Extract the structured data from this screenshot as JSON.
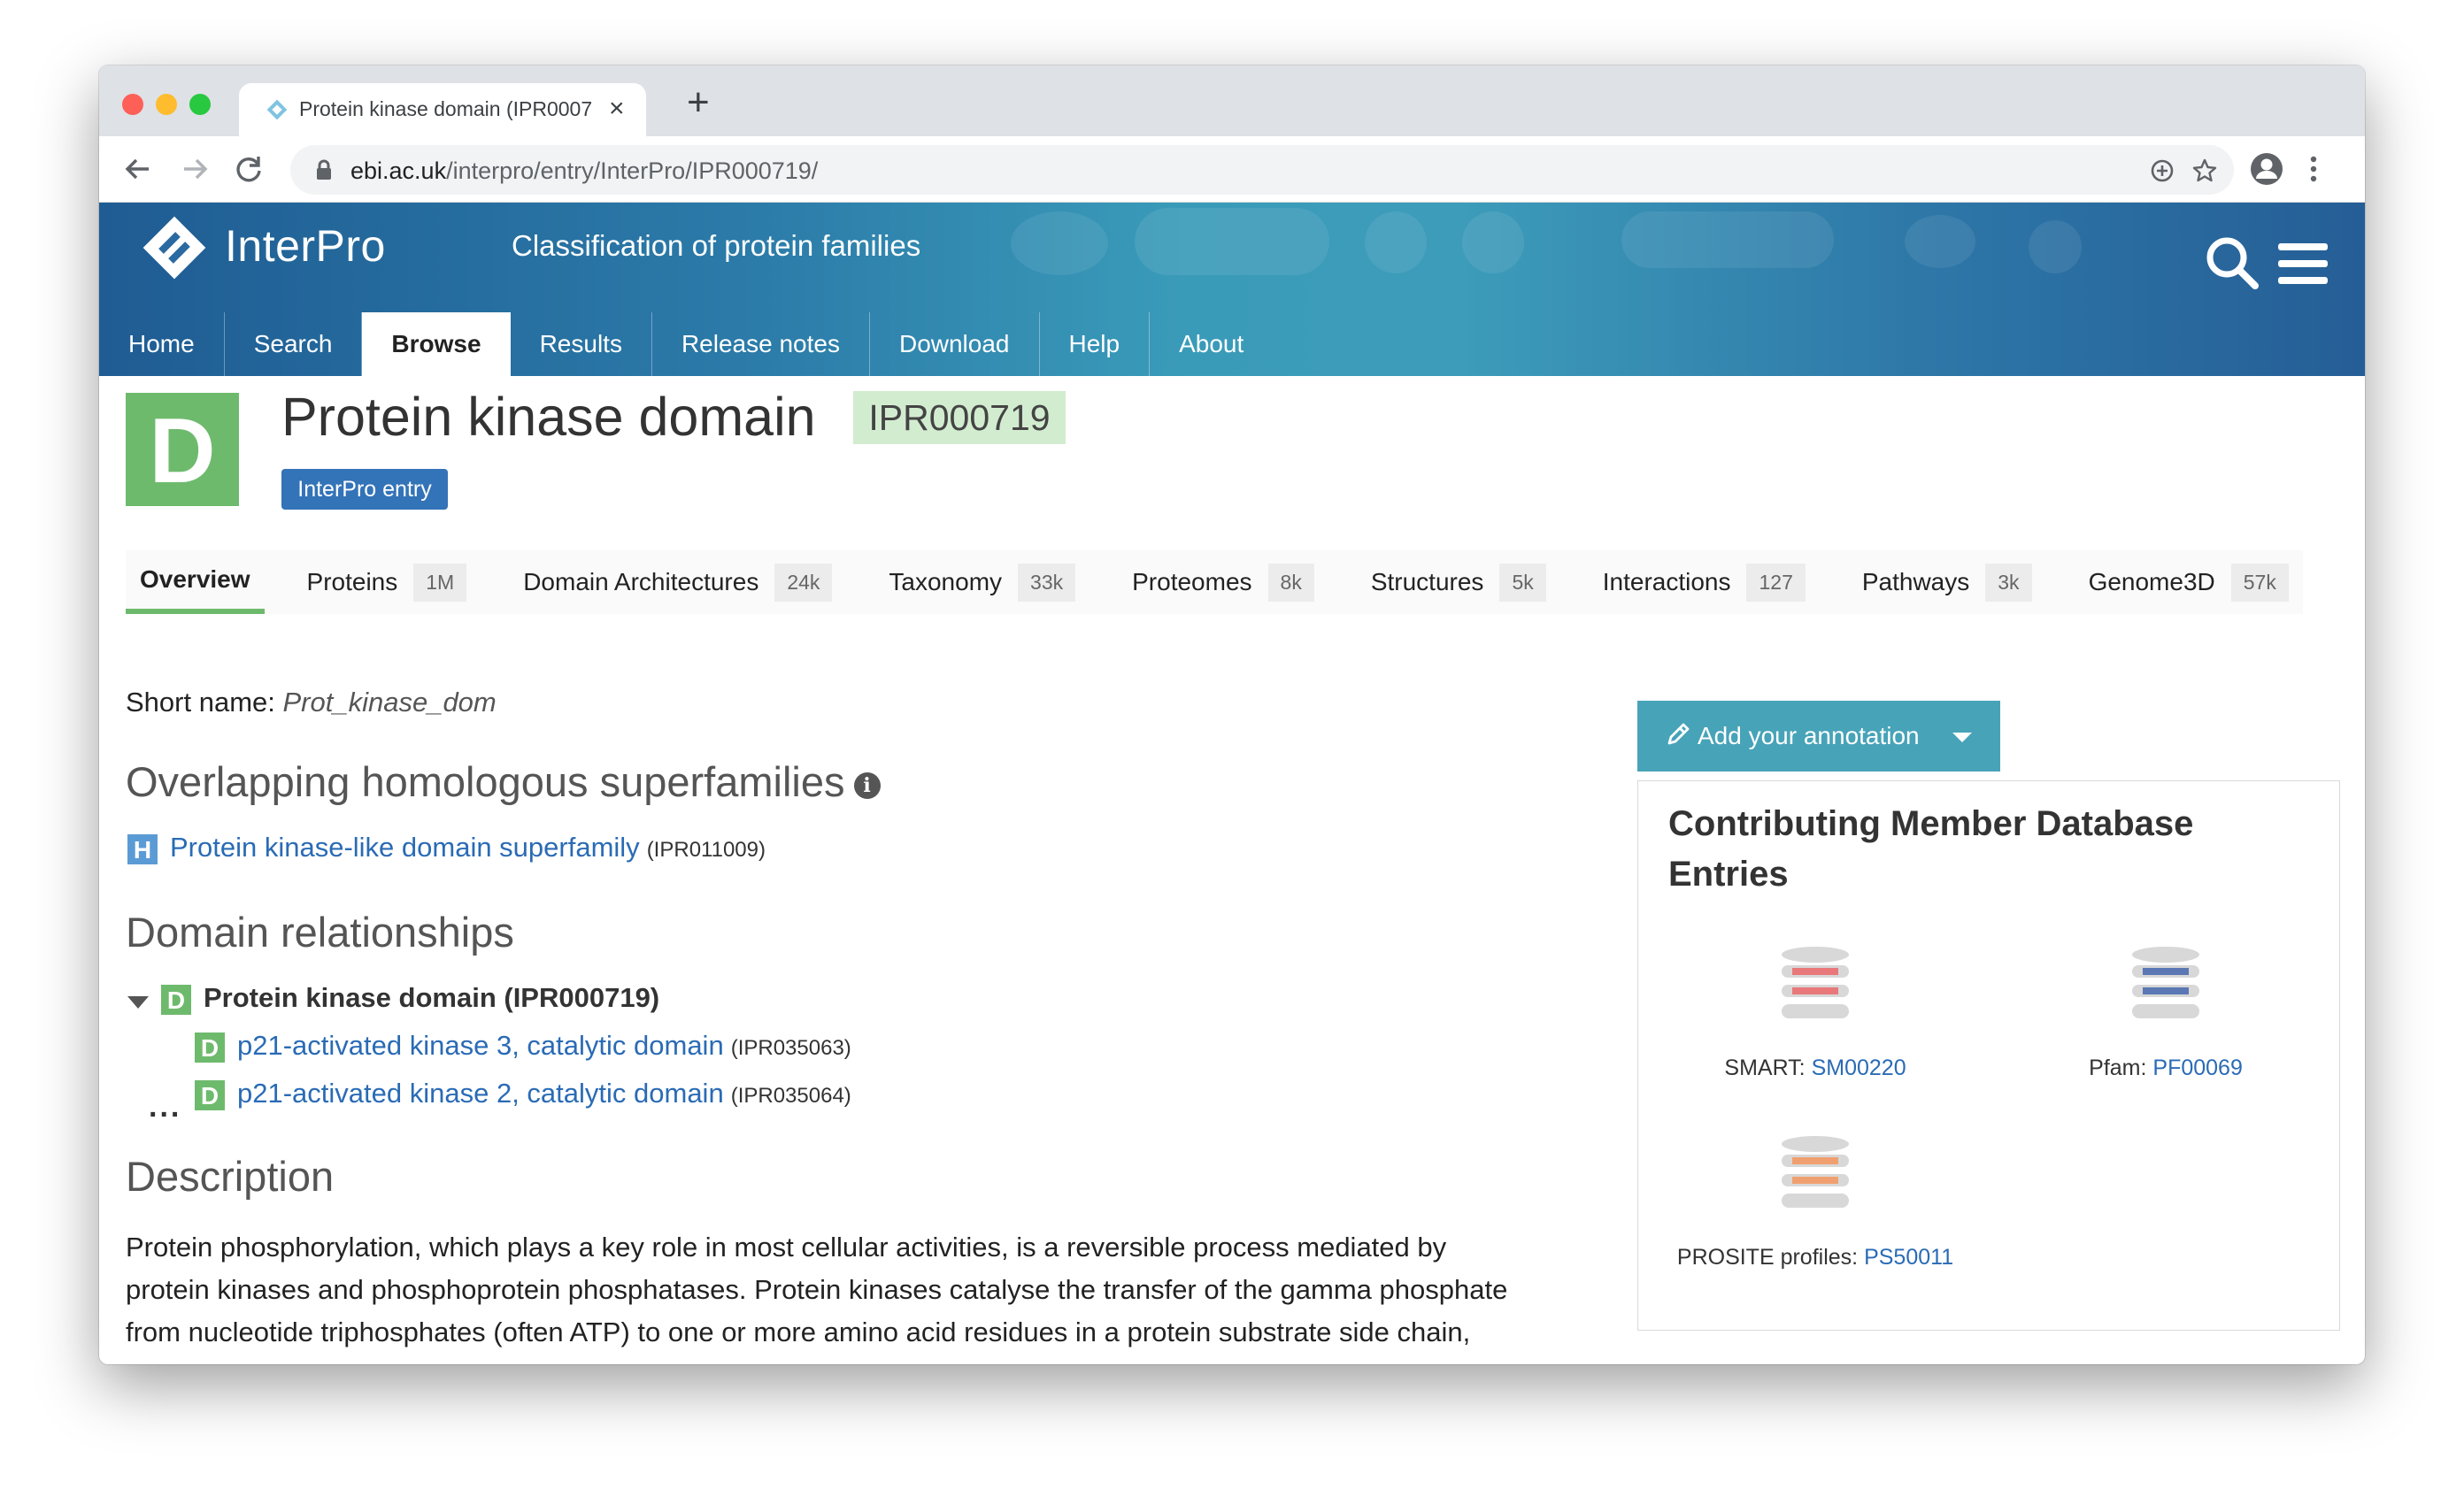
{
  "browser": {
    "tab_title": "Protein kinase domain (IPR0007",
    "url_host": "ebi.ac.uk",
    "url_path": "/interpro/entry/InterPro/IPR000719/"
  },
  "header": {
    "logo": "InterPro",
    "tagline": "Classification of protein families",
    "nav": [
      "Home",
      "Search",
      "Browse",
      "Results",
      "Release notes",
      "Download",
      "Help",
      "About"
    ],
    "active_nav": "Browse"
  },
  "entry": {
    "type_letter": "D",
    "title": "Protein kinase domain",
    "accession": "IPR000719",
    "type_label": "InterPro entry",
    "tabs": [
      {
        "label": "Overview",
        "count": ""
      },
      {
        "label": "Proteins",
        "count": "1M"
      },
      {
        "label": "Domain Architectures",
        "count": "24k"
      },
      {
        "label": "Taxonomy",
        "count": "33k"
      },
      {
        "label": "Proteomes",
        "count": "8k"
      },
      {
        "label": "Structures",
        "count": "5k"
      },
      {
        "label": "Interactions",
        "count": "127"
      },
      {
        "label": "Pathways",
        "count": "3k"
      },
      {
        "label": "Genome3D",
        "count": "57k"
      }
    ]
  },
  "overview": {
    "short_name_label": "Short name:",
    "short_name": "Prot_kinase_dom",
    "superfamilies_heading": "Overlapping homologous superfamilies",
    "superfamily": {
      "letter": "H",
      "name": "Protein kinase-like domain superfamily",
      "accession": "(IPR011009)"
    },
    "relationships_heading": "Domain relationships",
    "relationships": [
      {
        "letter": "D",
        "name": "Protein kinase domain (IPR000719)",
        "accession": ""
      },
      {
        "letter": "D",
        "name": "p21-activated kinase 3, catalytic domain",
        "accession": "(IPR035063)"
      },
      {
        "letter": "D",
        "name": "p21-activated kinase 2, catalytic domain",
        "accession": "(IPR035064)"
      }
    ],
    "more_dots": "...",
    "description_heading": "Description",
    "description": [
      "Protein phosphorylation, which plays a key role in most cellular activities, is a reversible process mediated by",
      "protein kinases and phosphoprotein phosphatases. Protein kinases catalyse the transfer of the gamma phosphate",
      "from nucleotide triphosphates (often ATP) to one or more amino acid residues in a protein substrate side chain,"
    ]
  },
  "sidebar": {
    "annotation_button": "Add your annotation",
    "panel_title": "Contributing Member Database Entries",
    "members": [
      {
        "db": "SMART:",
        "acc": "SM00220",
        "color": "#e8787a"
      },
      {
        "db": "Pfam:",
        "acc": "PF00069",
        "color": "#5b78b4"
      },
      {
        "db": "PROSITE profiles:",
        "acc": "PS50011",
        "color": "#f0a070"
      }
    ]
  },
  "colors": {
    "domain_green": "#6eba6d",
    "link_blue": "#2a6bb5",
    "header_blue": "#1f5c93",
    "annotation_teal": "#47a3b8"
  }
}
